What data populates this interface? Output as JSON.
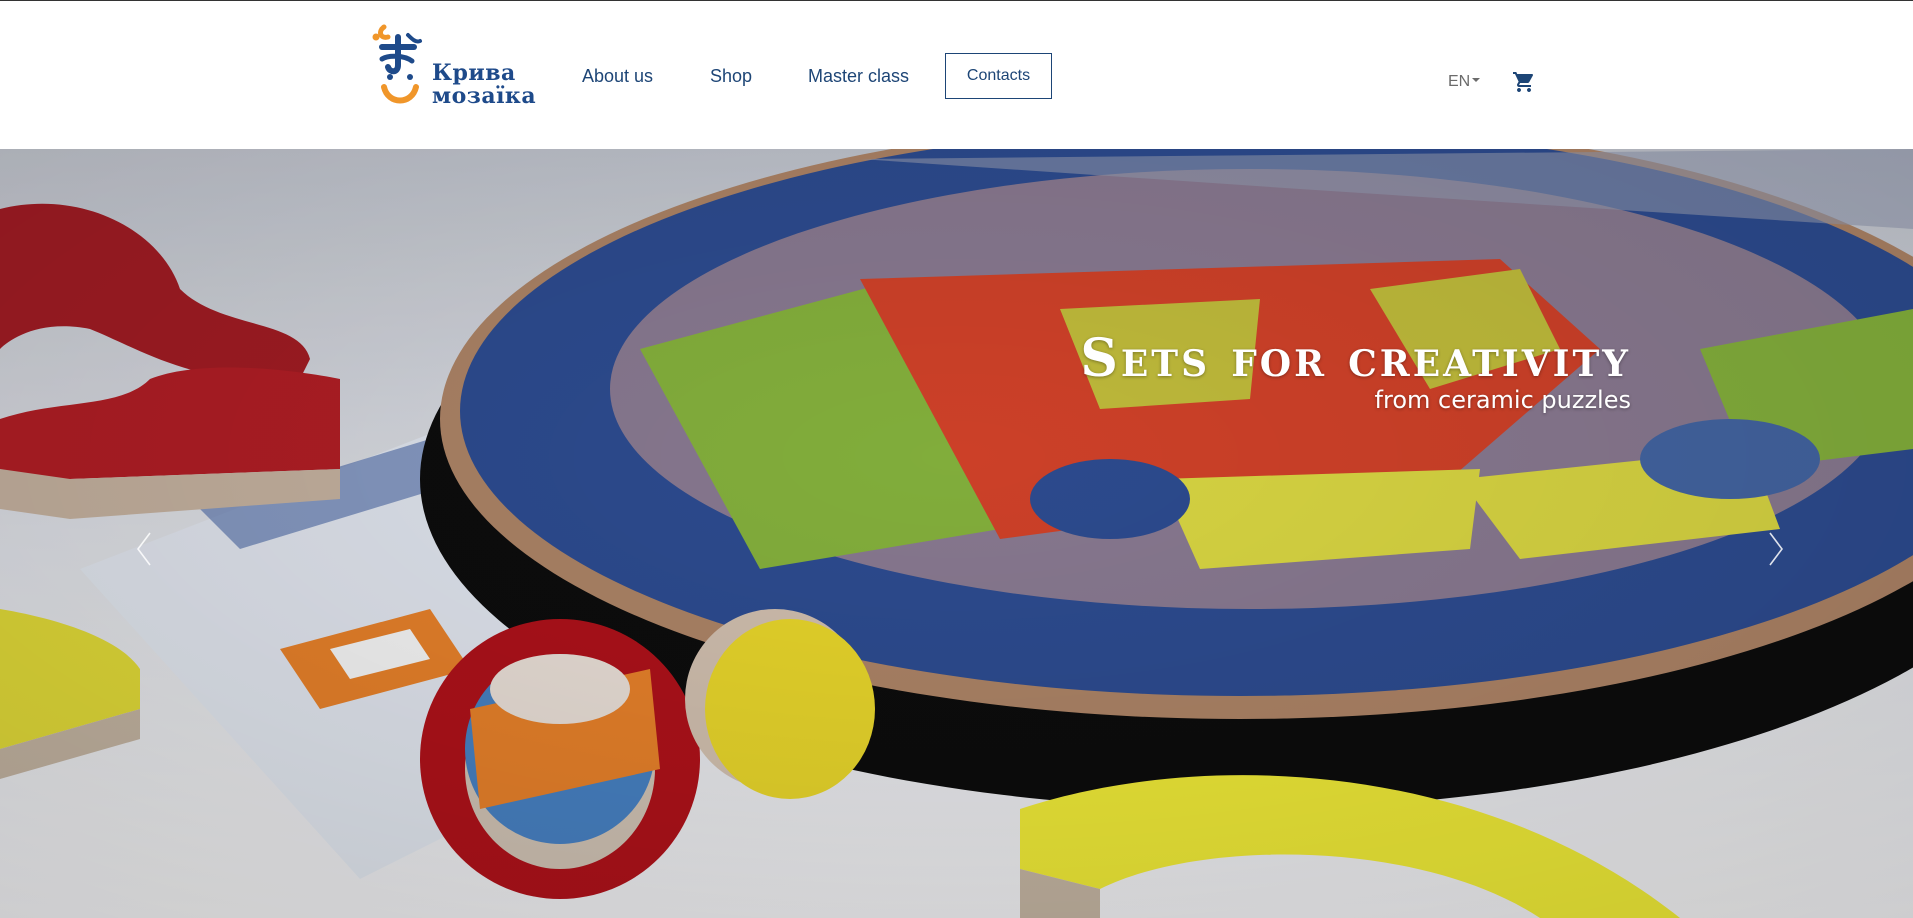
{
  "brand": {
    "logo_line1": "Крива",
    "logo_line2": "мозаїка",
    "colors": {
      "primary": "#1d4576",
      "accent": "#f0962a",
      "logo_blue": "#1e4a8a"
    }
  },
  "nav": {
    "items": [
      {
        "label": "About us"
      },
      {
        "label": "Shop"
      },
      {
        "label": "Master class"
      }
    ],
    "contacts_label": "Contacts",
    "language": "EN",
    "icons": {
      "cart": "cart-icon",
      "language_caret": "chevron-down-icon"
    }
  },
  "hero": {
    "title": "Sets for creativity",
    "subtitle": "from ceramic puzzles",
    "icons": {
      "prev": "chevron-left-icon",
      "next": "chevron-right-icon"
    }
  }
}
